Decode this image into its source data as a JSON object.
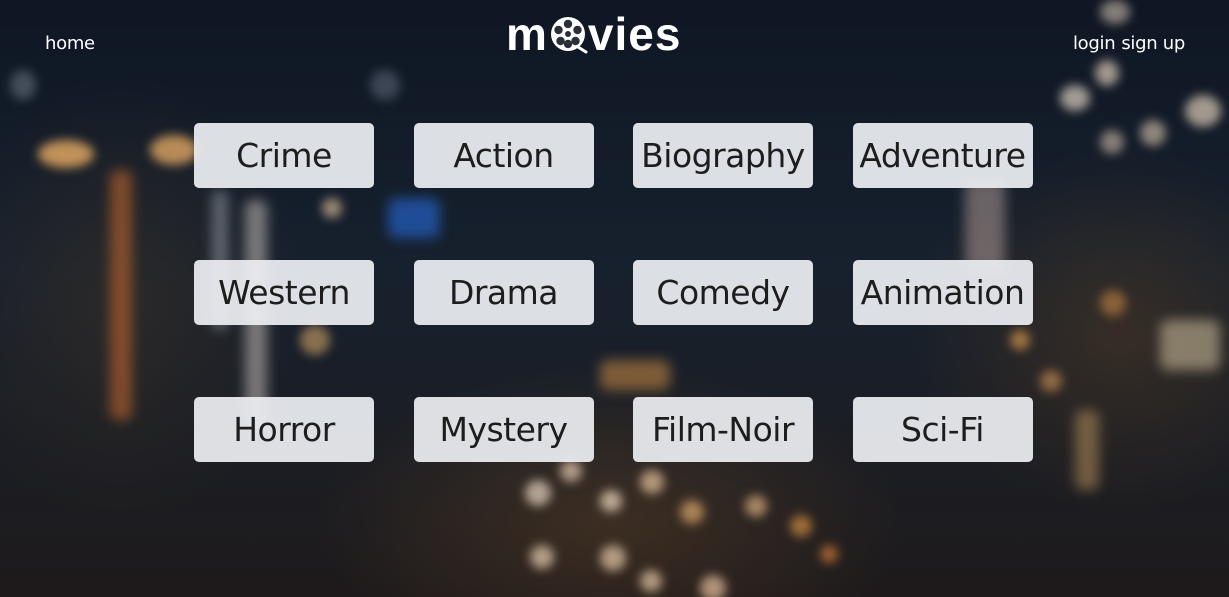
{
  "header": {
    "home_label": "home",
    "logo_text_left": "m",
    "logo_text_right": "vies",
    "logo_icon": "film-reel-icon",
    "login_label": "login",
    "signup_label": "sign up"
  },
  "genres": [
    {
      "label": "Crime"
    },
    {
      "label": "Action"
    },
    {
      "label": "Biography"
    },
    {
      "label": "Adventure"
    },
    {
      "label": "Western"
    },
    {
      "label": "Drama"
    },
    {
      "label": "Comedy"
    },
    {
      "label": "Animation"
    },
    {
      "label": "Horror"
    },
    {
      "label": "Mystery"
    },
    {
      "label": "Film-Noir"
    },
    {
      "label": "Sci-Fi"
    }
  ],
  "colors": {
    "button_bg": "#eceef2",
    "button_text": "#1d1d1d",
    "nav_text": "#ffffff"
  }
}
